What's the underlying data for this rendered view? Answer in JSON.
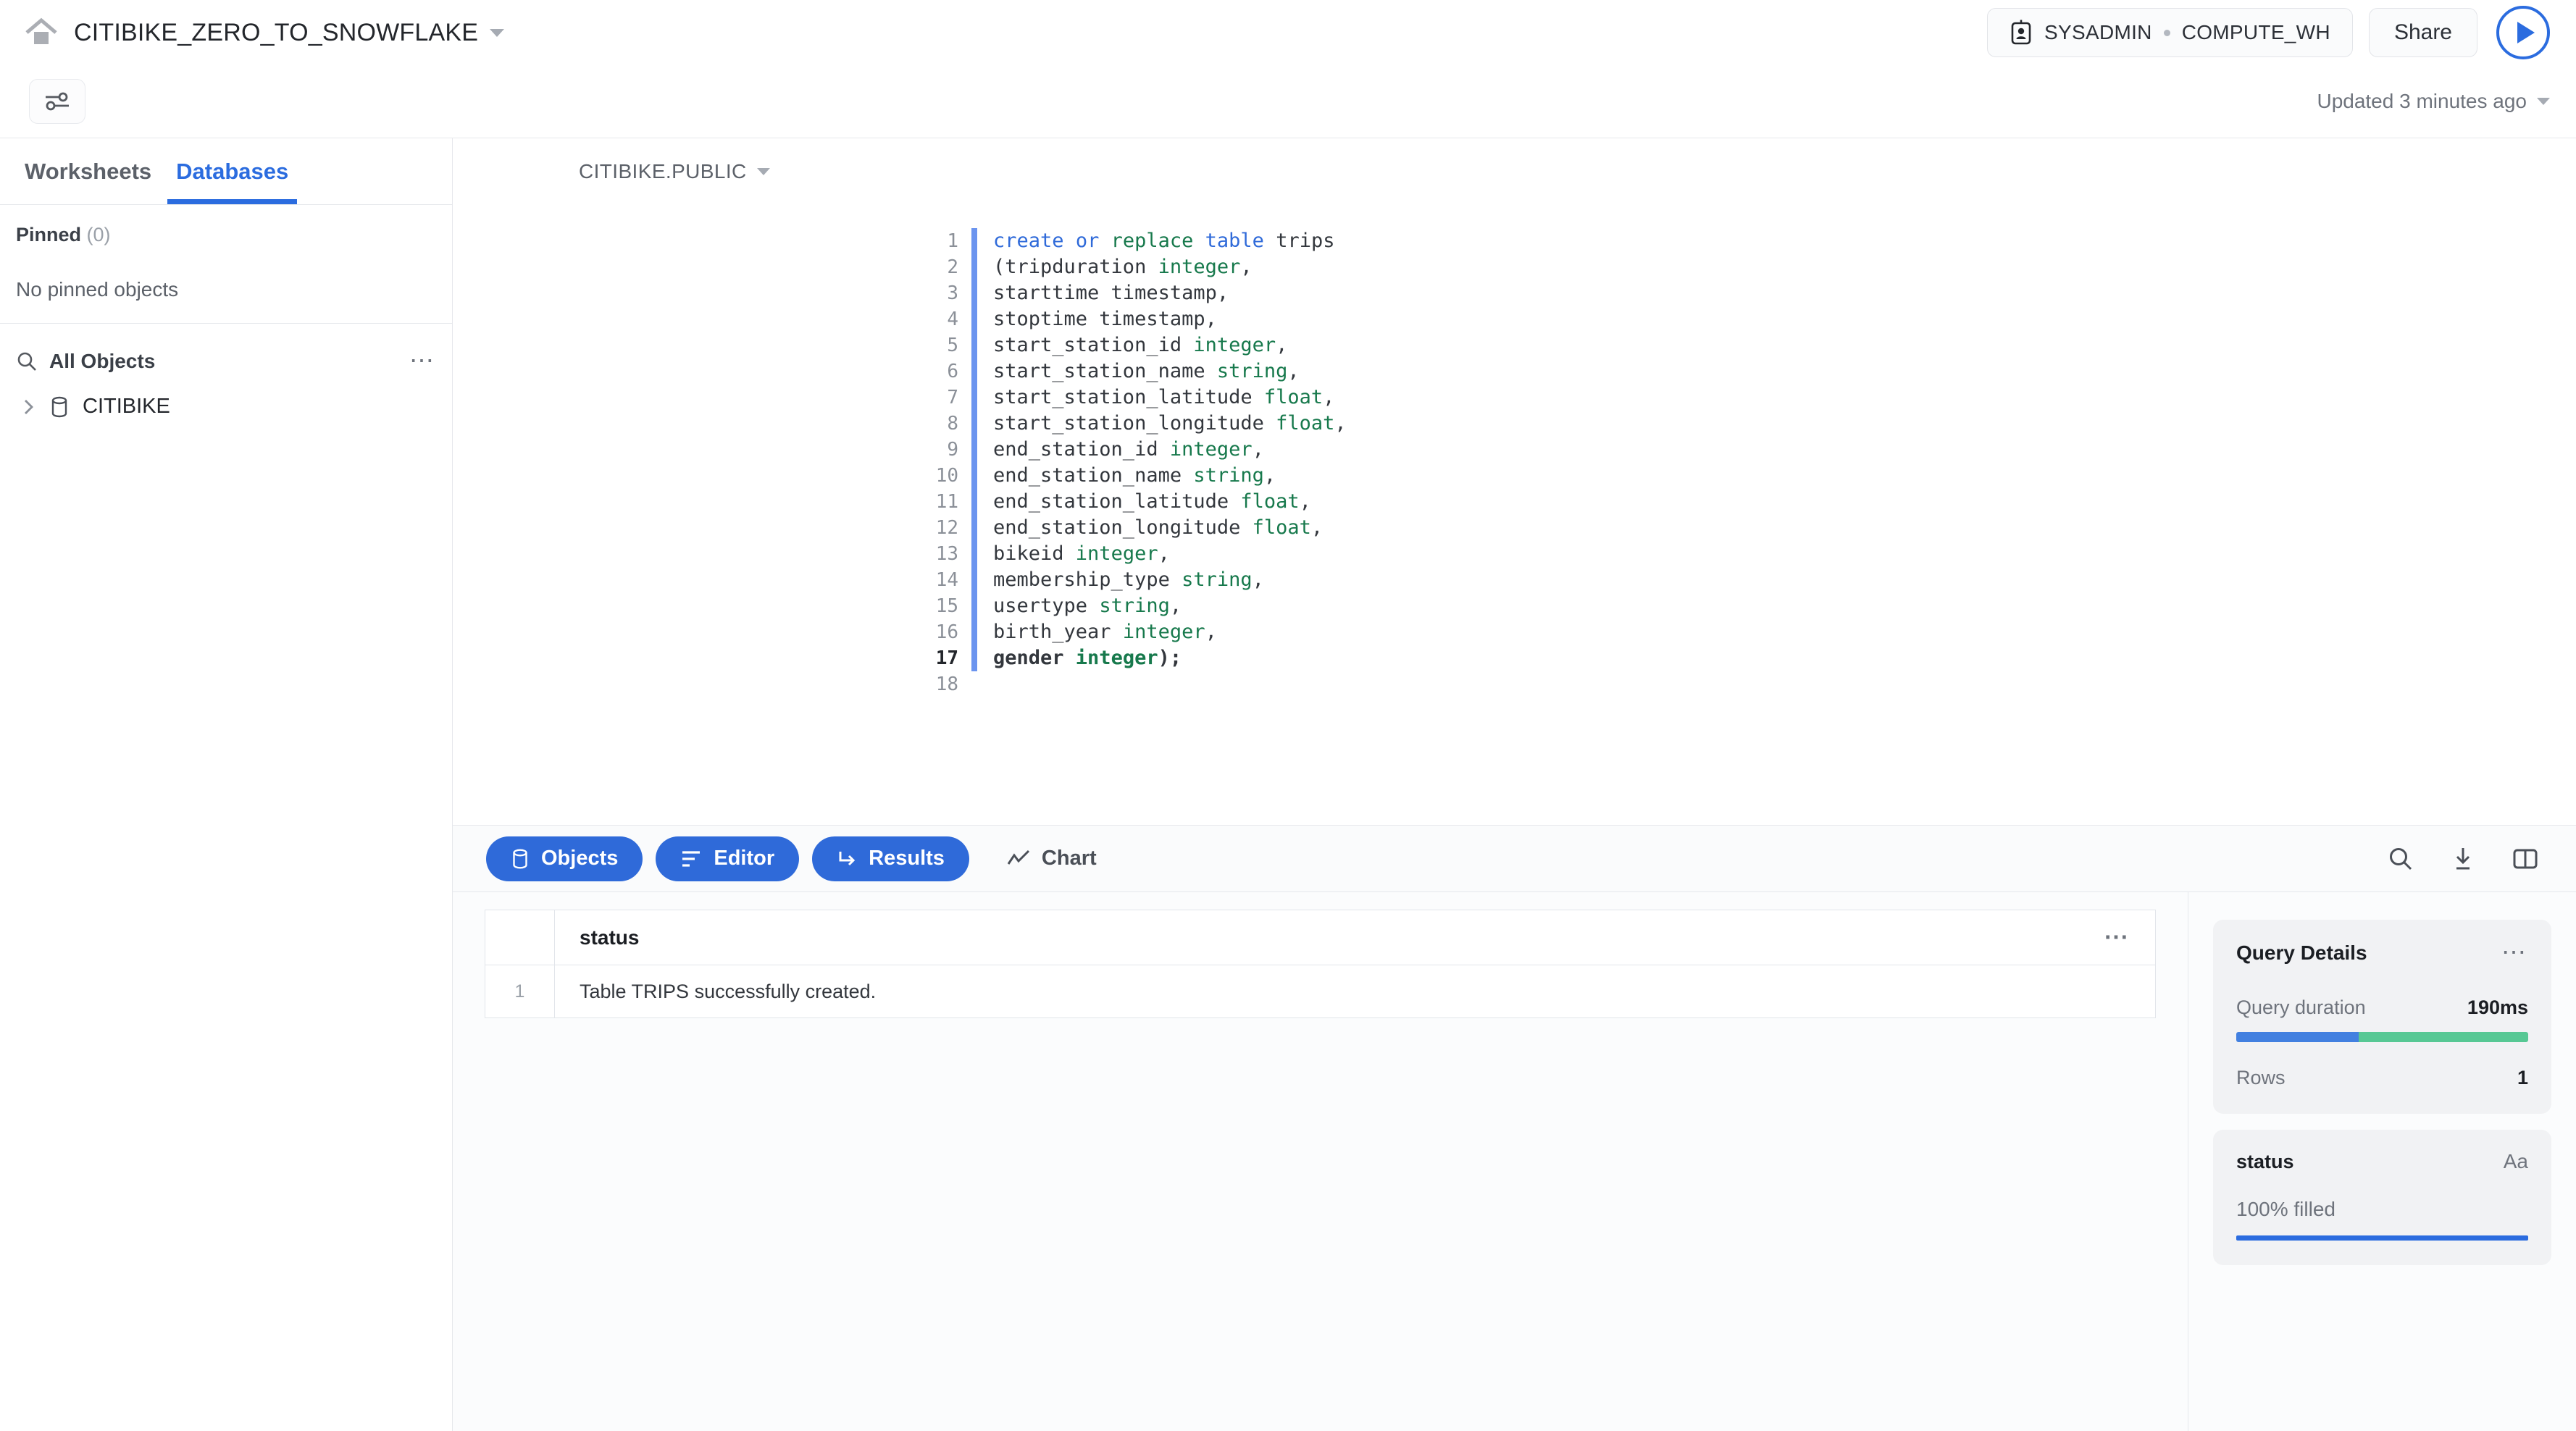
{
  "header": {
    "home_icon": "home-icon",
    "worksheet_title": "CITIBIKE_ZERO_TO_SNOWFLAKE",
    "title_caret": "chevron-down-icon",
    "role": "SYSADMIN",
    "warehouse": "COMPUTE_WH",
    "share_label": "Share",
    "run_icon": "play-icon"
  },
  "subbar": {
    "filter_icon": "sliders-icon",
    "updated_text": "Updated 3 minutes ago",
    "updated_caret": "chevron-down-icon"
  },
  "sidebar": {
    "tabs": [
      {
        "label": "Worksheets",
        "active": false
      },
      {
        "label": "Databases",
        "active": true
      }
    ],
    "pinned": {
      "label": "Pinned",
      "count": "(0)",
      "empty_text": "No pinned objects"
    },
    "all_objects": {
      "search_icon": "search-icon",
      "label": "All Objects",
      "more_icon": "ellipsis-icon"
    },
    "tree": [
      {
        "expand_icon": "chevron-right-icon",
        "db_icon": "database-icon",
        "label": "CITIBIKE"
      }
    ]
  },
  "editor": {
    "context": "CITIBIKE.PUBLIC",
    "context_caret": "chevron-down-icon",
    "active_line": 17,
    "total_lines": 18,
    "lines": [
      {
        "n": 1,
        "tokens": [
          {
            "t": "create",
            "c": "kw"
          },
          {
            "t": " "
          },
          {
            "t": "or",
            "c": "kw"
          },
          {
            "t": " "
          },
          {
            "t": "replace",
            "c": "kw2"
          },
          {
            "t": " "
          },
          {
            "t": "table",
            "c": "kw"
          },
          {
            "t": " trips"
          }
        ]
      },
      {
        "n": 2,
        "tokens": [
          {
            "t": "(tripduration "
          },
          {
            "t": "integer",
            "c": "ty"
          },
          {
            "t": ","
          }
        ]
      },
      {
        "n": 3,
        "tokens": [
          {
            "t": "starttime timestamp,"
          }
        ]
      },
      {
        "n": 4,
        "tokens": [
          {
            "t": "stoptime timestamp,"
          }
        ]
      },
      {
        "n": 5,
        "tokens": [
          {
            "t": "start_station_id "
          },
          {
            "t": "integer",
            "c": "ty"
          },
          {
            "t": ","
          }
        ]
      },
      {
        "n": 6,
        "tokens": [
          {
            "t": "start_station_name "
          },
          {
            "t": "string",
            "c": "ty"
          },
          {
            "t": ","
          }
        ]
      },
      {
        "n": 7,
        "tokens": [
          {
            "t": "start_station_latitude "
          },
          {
            "t": "float",
            "c": "ty"
          },
          {
            "t": ","
          }
        ]
      },
      {
        "n": 8,
        "tokens": [
          {
            "t": "start_station_longitude "
          },
          {
            "t": "float",
            "c": "ty"
          },
          {
            "t": ","
          }
        ]
      },
      {
        "n": 9,
        "tokens": [
          {
            "t": "end_station_id "
          },
          {
            "t": "integer",
            "c": "ty"
          },
          {
            "t": ","
          }
        ]
      },
      {
        "n": 10,
        "tokens": [
          {
            "t": "end_station_name "
          },
          {
            "t": "string",
            "c": "ty"
          },
          {
            "t": ","
          }
        ]
      },
      {
        "n": 11,
        "tokens": [
          {
            "t": "end_station_latitude "
          },
          {
            "t": "float",
            "c": "ty"
          },
          {
            "t": ","
          }
        ]
      },
      {
        "n": 12,
        "tokens": [
          {
            "t": "end_station_longitude "
          },
          {
            "t": "float",
            "c": "ty"
          },
          {
            "t": ","
          }
        ]
      },
      {
        "n": 13,
        "tokens": [
          {
            "t": "bikeid "
          },
          {
            "t": "integer",
            "c": "ty"
          },
          {
            "t": ","
          }
        ]
      },
      {
        "n": 14,
        "tokens": [
          {
            "t": "membership_type "
          },
          {
            "t": "string",
            "c": "ty"
          },
          {
            "t": ","
          }
        ]
      },
      {
        "n": 15,
        "tokens": [
          {
            "t": "usertype "
          },
          {
            "t": "string",
            "c": "ty"
          },
          {
            "t": ","
          }
        ]
      },
      {
        "n": 16,
        "tokens": [
          {
            "t": "birth_year "
          },
          {
            "t": "integer",
            "c": "ty"
          },
          {
            "t": ","
          }
        ]
      },
      {
        "n": 17,
        "tokens": [
          {
            "t": "gender "
          },
          {
            "t": "integer",
            "c": "ty"
          },
          {
            "t": ");"
          }
        ]
      },
      {
        "n": 18,
        "tokens": [
          {
            "t": ""
          }
        ]
      }
    ]
  },
  "bottom_toolbar": {
    "segments": [
      {
        "label": "Objects",
        "icon": "database-icon",
        "active": true
      },
      {
        "label": "Editor",
        "icon": "lines-icon",
        "active": true
      },
      {
        "label": "Results",
        "icon": "arrow-return-icon",
        "active": true
      },
      {
        "label": "Chart",
        "icon": "line-chart-icon",
        "active": false
      }
    ],
    "icons": [
      {
        "name": "search-icon"
      },
      {
        "name": "download-icon"
      },
      {
        "name": "split-panel-icon"
      }
    ]
  },
  "results": {
    "columns": [
      "status"
    ],
    "more_icon": "ellipsis-icon",
    "rows": [
      {
        "num": "1",
        "cells": [
          "Table TRIPS successfully created."
        ]
      }
    ]
  },
  "query_details": {
    "title": "Query Details",
    "more_icon": "ellipsis-icon",
    "duration_label": "Query duration",
    "duration_value": "190ms",
    "bar_blue_pct": 42,
    "bar_green_pct": 58,
    "bar_blue_color": "#4280e0",
    "bar_green_color": "#57c894",
    "rows_label": "Rows",
    "rows_value": "1",
    "column_stat": {
      "name": "status",
      "type_badge": "Aa",
      "filled_text": "100% filled",
      "filled_pct": 100,
      "fill_color": "#2b6cdf"
    }
  }
}
